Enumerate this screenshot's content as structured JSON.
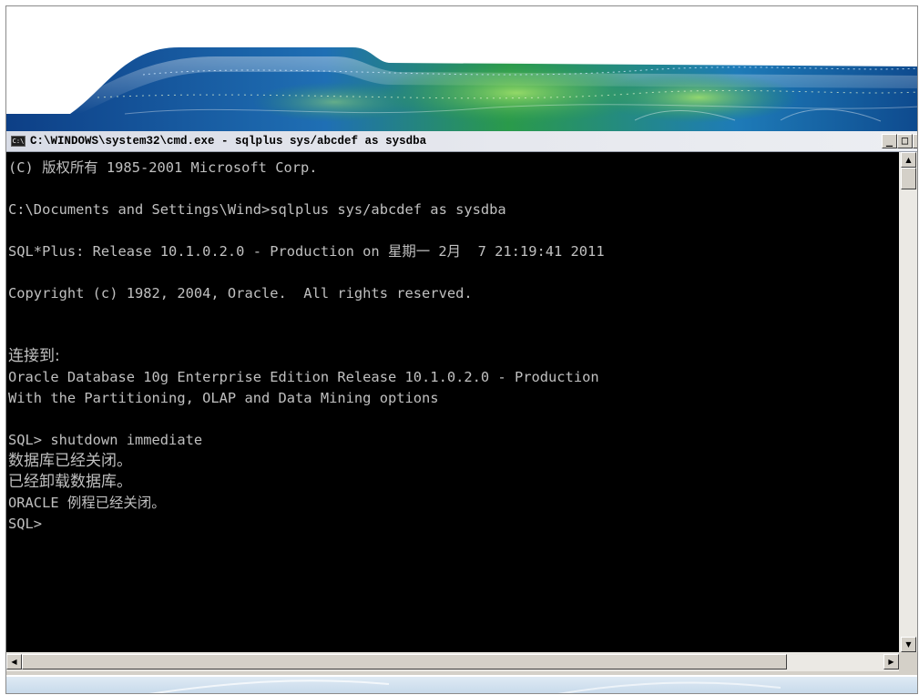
{
  "window": {
    "title": "C:\\WINDOWS\\system32\\cmd.exe - sqlplus sys/abcdef as sysdba",
    "icon_label": "C:\\",
    "minimize_label": "_",
    "maximize_label": "□",
    "close_label": "×"
  },
  "console": {
    "lines": [
      "(C) 版权所有 1985-2001 Microsoft Corp.",
      "",
      "C:\\Documents and Settings\\Wind>sqlplus sys/abcdef as sysdba",
      "",
      "SQL*Plus: Release 10.1.0.2.0 - Production on 星期一 2月  7 21:19:41 2011",
      "",
      "Copyright (c) 1982, 2004, Oracle.  All rights reserved.",
      "",
      "",
      "连接到:",
      "Oracle Database 10g Enterprise Edition Release 10.1.0.2.0 - Production",
      "With the Partitioning, OLAP and Data Mining options",
      "",
      "SQL> shutdown immediate",
      "数据库已经关闭。",
      "已经卸载数据库。",
      "ORACLE 例程已经关闭。",
      "SQL>"
    ]
  },
  "scrollbar": {
    "up_arrow": "▲",
    "down_arrow": "▼",
    "left_arrow": "◀",
    "right_arrow": "▶"
  },
  "colors": {
    "console_bg": "#000000",
    "console_text": "#c0c0c0",
    "banner_green": "#2e8b3a",
    "banner_blue": "#1f5aa8"
  }
}
